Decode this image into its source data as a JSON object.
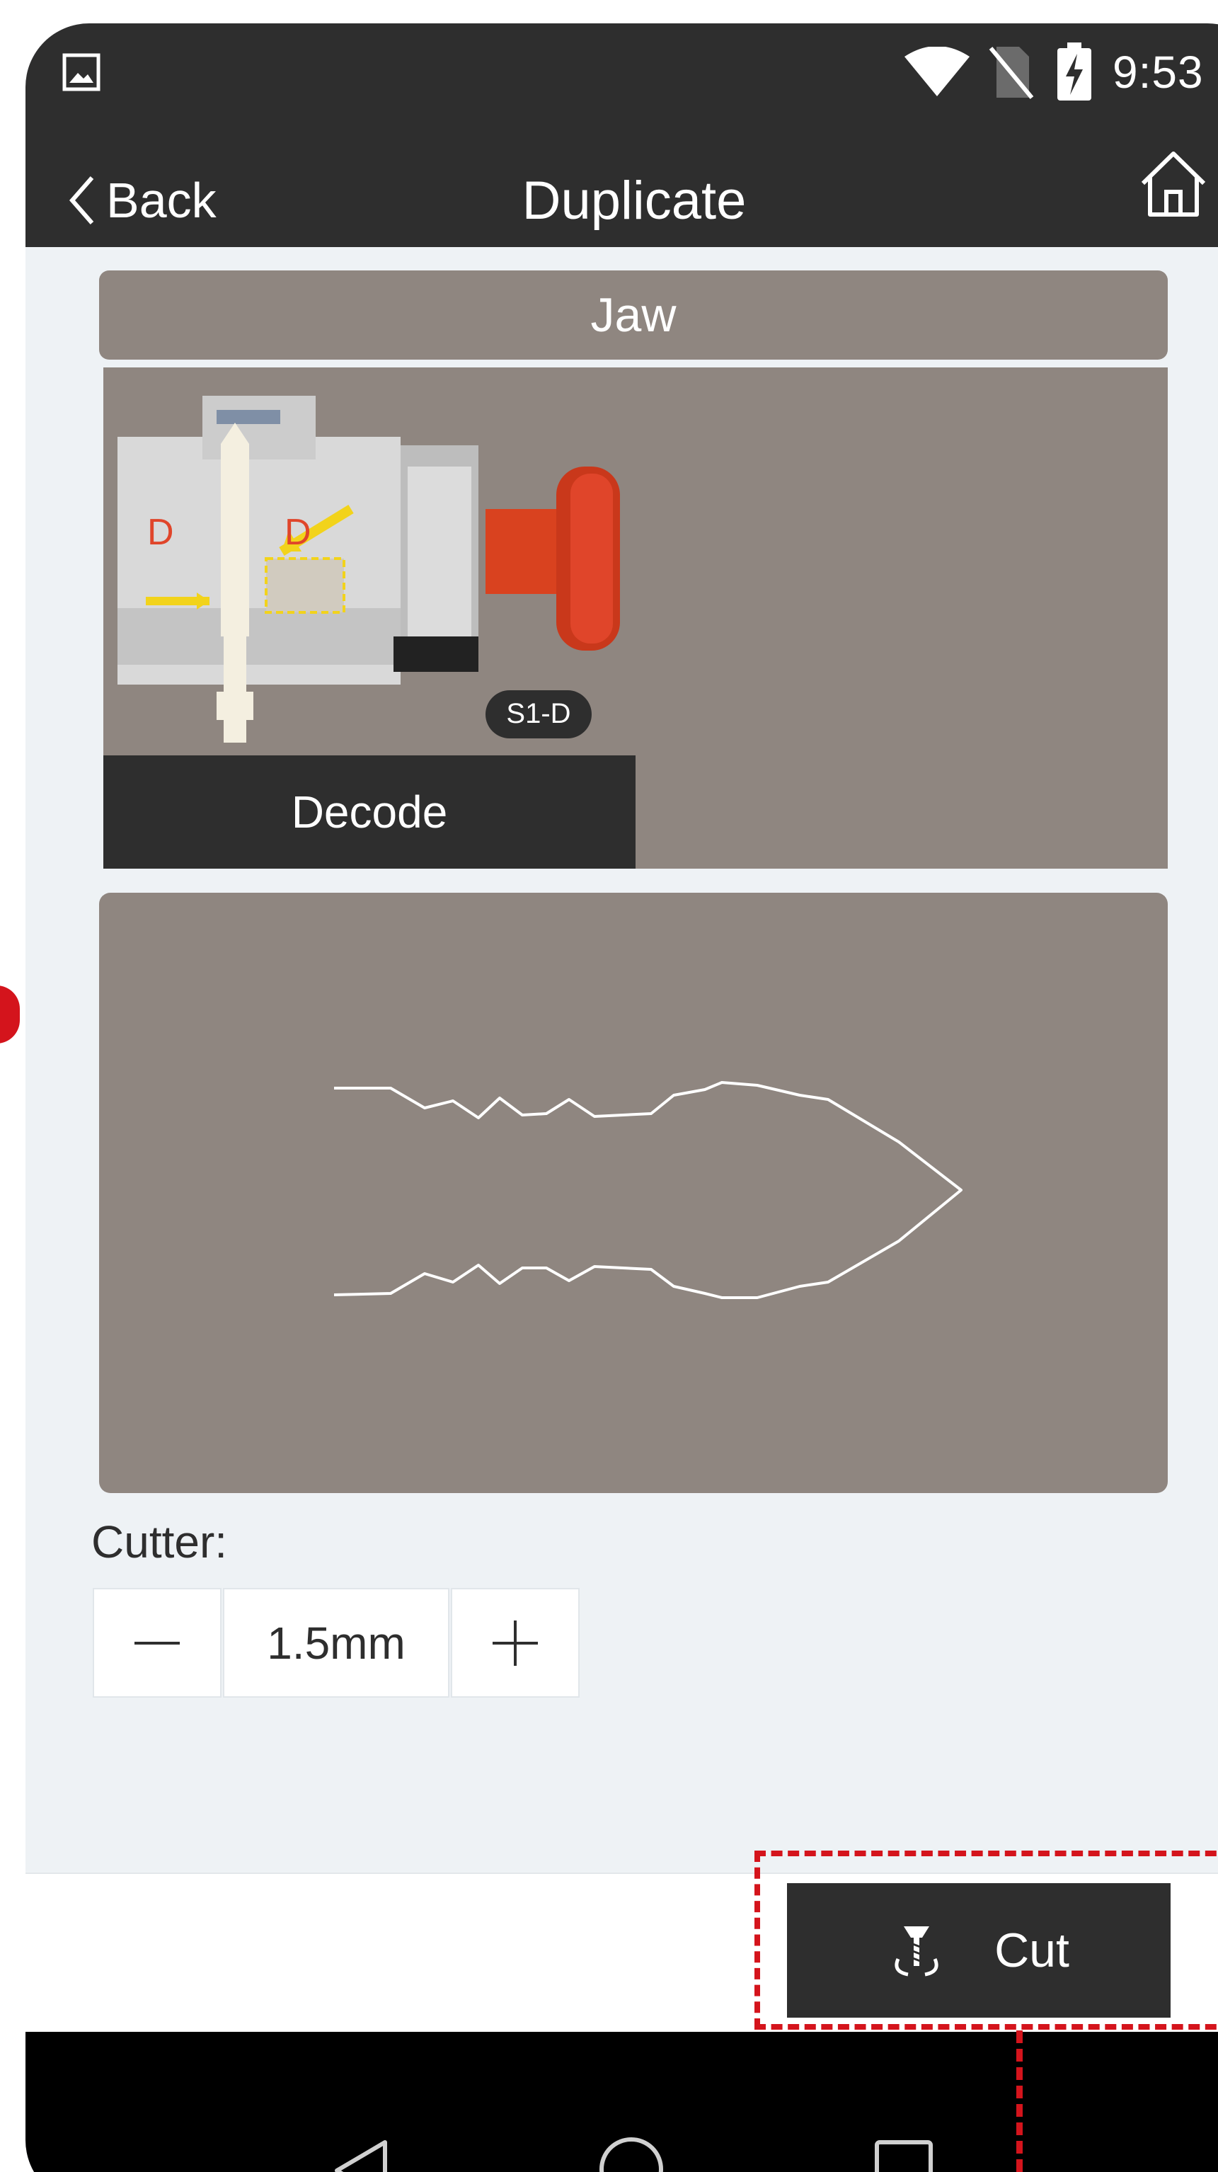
{
  "status_bar": {
    "time": "9:53",
    "icons": [
      "image-icon",
      "wifi-icon",
      "no-sim-icon",
      "battery-charging-icon"
    ]
  },
  "header": {
    "back_label": "Back",
    "title": "Duplicate",
    "home_icon": "home-icon"
  },
  "jaw": {
    "title": "Jaw",
    "decode_label": "Decode",
    "clamp_side_label_left": "D",
    "clamp_side_label_right": "D",
    "jaw_badge": "S1-D"
  },
  "cutter": {
    "label": "Cutter:",
    "value": "1.5mm",
    "decrement_icon": "minus-icon",
    "increment_icon": "plus-icon"
  },
  "actions": {
    "cut_label": "Cut",
    "cut_icon": "cutter-icon"
  },
  "nav_bar": {
    "buttons": [
      "back-triangle-icon",
      "home-circle-icon",
      "recents-square-icon"
    ]
  },
  "colors": {
    "bar_dark": "#2e2e2e",
    "panel": "#8f8680",
    "background": "#eef2f5",
    "annotation": "#d4141c",
    "jaw_red": "#e0452a",
    "arrow_yellow": "#f2d31b"
  }
}
